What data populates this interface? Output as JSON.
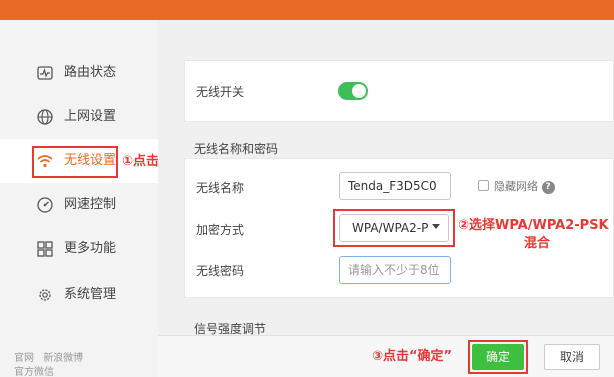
{
  "sidebar": {
    "items": [
      {
        "label": "路由状态",
        "icon": "pulse-icon"
      },
      {
        "label": "上网设置",
        "icon": "globe-icon"
      },
      {
        "label": "无线设置",
        "icon": "wifi-icon"
      },
      {
        "label": "网速控制",
        "icon": "speed-gauge-icon"
      },
      {
        "label": "更多功能",
        "icon": "grid-icon"
      },
      {
        "label": "系统管理",
        "icon": "gear-icon"
      }
    ],
    "footer": {
      "official_site": "官网",
      "weibo": "新浪微博",
      "wechat": "官方微信"
    }
  },
  "wifi": {
    "switch_label": "无线开关",
    "switch_on": true,
    "section_title": "无线名称和密码",
    "name_label": "无线名称",
    "name_value": "Tenda_F3D5C0",
    "hide_network_label": "隐藏网络",
    "help_symbol": "?",
    "security_label": "加密方式",
    "security_value": "WPA/WPA2-P",
    "password_label": "无线密码",
    "password_placeholder": "请输入不少于8位",
    "signal_section_title": "信号强度调节"
  },
  "annotations": {
    "step1": "①点击",
    "step2_line1": "②选择WPA/WPA2-PSK",
    "step2_line2": "混合",
    "step3": "③点击“确定”"
  },
  "actions": {
    "ok_label": "确定",
    "cancel_label": "取消"
  },
  "colors": {
    "accent": "#e96a25",
    "annotation": "#e53935",
    "toggle_on": "#3fbf5a",
    "ok_button": "#3fbf3f"
  }
}
